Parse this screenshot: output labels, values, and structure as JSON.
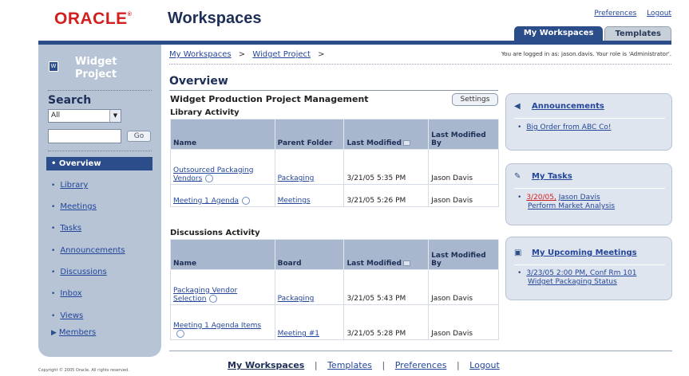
{
  "brand": {
    "logo": "ORACLE",
    "app_title": "Workspaces"
  },
  "toplinks": {
    "preferences": "Preferences",
    "logout": "Logout"
  },
  "tabs": [
    {
      "label": "My Workspaces"
    },
    {
      "label": "Templates"
    }
  ],
  "sidebar": {
    "title": "Widget Project",
    "search_label": "Search",
    "search_scope": "All",
    "go_label": "Go",
    "nav": [
      {
        "label": "Overview"
      },
      {
        "label": "Library"
      },
      {
        "label": "Meetings"
      },
      {
        "label": "Tasks"
      },
      {
        "label": "Announcements"
      },
      {
        "label": "Discussions"
      },
      {
        "label": "Inbox"
      },
      {
        "label": "Views"
      },
      {
        "label": "Members"
      }
    ],
    "copyright": "Copyright © 2005 Oracle. All rights reserved."
  },
  "breadcrumb": {
    "items": [
      "My Workspaces",
      "Widget Project"
    ],
    "sep": ">"
  },
  "userinfo": "You are logged in as: jason.davis. Your role is 'Administrator'.",
  "overview": {
    "title": "Overview",
    "project": "Widget Production Project Management",
    "settings_label": "Settings"
  },
  "library": {
    "title": "Library Activity",
    "headers": [
      "Name",
      "Parent Folder",
      "Last Modified",
      "Last Modified By"
    ],
    "rows": [
      {
        "name": "Outsourced Packaging Vendors",
        "folder": "Packaging",
        "modified": "3/21/05 5:35 PM",
        "by": "Jason Davis"
      },
      {
        "name": "Meeting 1 Agenda",
        "folder": "Meetings",
        "modified": "3/21/05 5:26 PM",
        "by": "Jason Davis"
      }
    ]
  },
  "discussions": {
    "title": "Discussions Activity",
    "headers": [
      "Name",
      "Board",
      "Last Modified",
      "Last Modified By"
    ],
    "rows": [
      {
        "name": "Packaging Vendor Selection",
        "board": "Packaging",
        "modified": "3/21/05 5:43 PM",
        "by": "Jason Davis"
      },
      {
        "name": "Meeting 1 Agenda Items",
        "board": "Meeting #1",
        "modified": "3/21/05 5:28 PM",
        "by": "Jason Davis"
      }
    ]
  },
  "announcements": {
    "title": "Announcements",
    "items": [
      "Big Order from ABC Co!"
    ]
  },
  "tasks": {
    "title": "My Tasks",
    "date": "3/20/05,",
    "who": "Jason Davis",
    "task": "Perform Market Analysis"
  },
  "meetings": {
    "title": "My Upcoming Meetings",
    "line1": "3/23/05 2:00 PM, Conf Rm 101",
    "line2": "Widget Packaging Status"
  },
  "footer": [
    "My Workspaces",
    "Templates",
    "Preferences",
    "Logout"
  ],
  "colors": {
    "brand_red": "#d11f1f",
    "nav_blue": "#2b4d8a",
    "sidebar": "#b6c4d6",
    "table_header": "#a8b7cd",
    "panel": "#dfe5ee"
  }
}
